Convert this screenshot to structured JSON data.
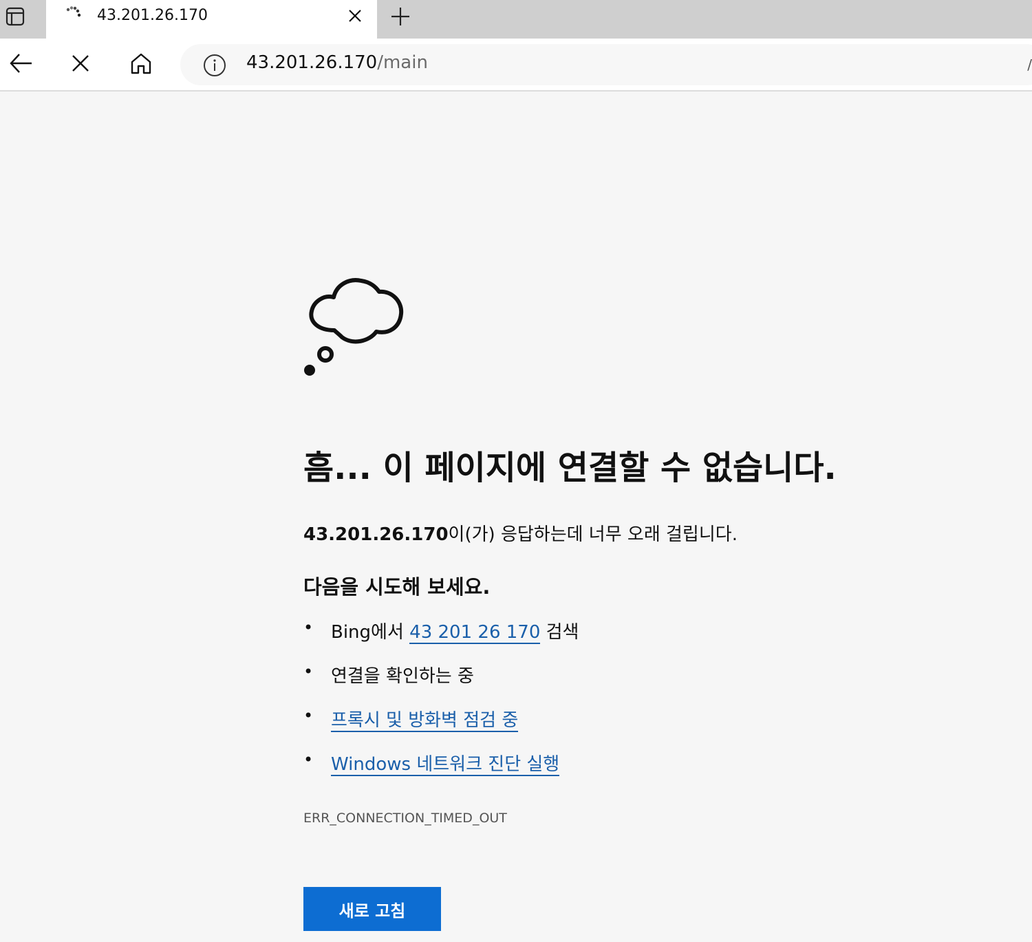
{
  "browser": {
    "tab": {
      "title": "43.201.26.170"
    },
    "address_bar": {
      "host": "43.201.26.170",
      "path": "/main"
    },
    "right_edge_glyph": "/",
    "icons": {
      "tab_actions": "tab-actions-icon",
      "tab_loading": "loading-spinner-icon",
      "tab_close": "close-icon",
      "new_tab": "plus-icon",
      "back": "back-arrow-icon",
      "stop": "stop-icon",
      "home": "home-icon",
      "site_info": "info-icon"
    }
  },
  "error_page": {
    "icon": "thought-cloud-icon",
    "heading": "흠... 이 페이지에 연결할 수 없습니다.",
    "description": {
      "host": "43.201.26.170",
      "text": "이(가) 응답하는데 너무 오래 걸립니다."
    },
    "try_heading": "다음을 시도해 보세요.",
    "suggestions": {
      "bing": {
        "prefix": "Bing에서 ",
        "link": "43 201 26 170",
        "suffix": " 검색"
      },
      "check_connection": "연결을 확인하는 중",
      "proxy_firewall": "프록시 및 방화벽 점검 중",
      "network_diagnostics": "Windows 네트워크 진단 실행"
    },
    "error_code": "ERR_CONNECTION_TIMED_OUT",
    "reload_label": "새로 고침"
  },
  "colors": {
    "link": "#1a5faa",
    "button": "#0d6dd2",
    "page_background": "#f6f6f6",
    "tabstrip": "#cfcfcf"
  }
}
